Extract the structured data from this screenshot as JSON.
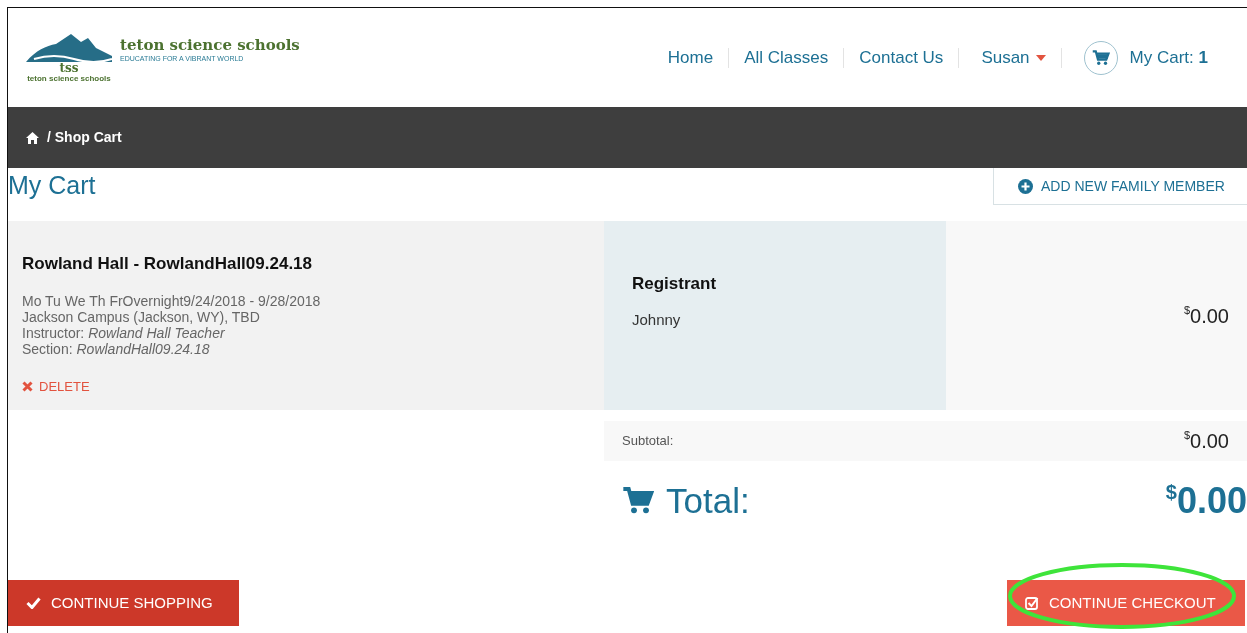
{
  "header": {
    "logo": {
      "name": "teton science schools",
      "tagline": "EDUCATING FOR A VIBRANT WORLD",
      "mark_letters": "tss",
      "mark_caption": "teton science schools"
    },
    "nav": [
      {
        "label": "Home",
        "kind": "link"
      },
      {
        "label": "All Classes",
        "kind": "link"
      },
      {
        "label": "Contact Us",
        "kind": "link"
      },
      {
        "label": "Susan",
        "kind": "dropdown"
      },
      {
        "label": "My Cart:",
        "count": "1",
        "kind": "cart"
      }
    ]
  },
  "breadcrumb": {
    "items": [
      "/ Shop Cart"
    ]
  },
  "page_title": "My Cart",
  "add_member_button": "ADD NEW FAMILY MEMBER",
  "cart_items": [
    {
      "title": "Rowland Hall - RowlandHall09.24.18",
      "schedule": "Mo Tu We Th FrOvernight9/24/2018 - 9/28/2018",
      "location": "Jackson Campus (Jackson, WY), TBD",
      "instructor_label": "Instructor:",
      "instructor": "Rowland Hall Teacher",
      "section_label": "Section:",
      "section": "RowlandHall09.24.18",
      "delete_label": "DELETE",
      "registrant_heading": "Registrant",
      "registrant": "Johnny",
      "price": {
        "symbol": "$",
        "amount": "0.00"
      }
    }
  ],
  "subtotal": {
    "label": "Subtotal:",
    "symbol": "$",
    "amount": "0.00"
  },
  "total": {
    "label": "Total:",
    "symbol": "$",
    "amount": "0.00"
  },
  "buttons": [
    {
      "label": "CONTINUE SHOPPING",
      "kind": "shopping",
      "highlighted": false
    },
    {
      "label": "CONTINUE CHECKOUT",
      "kind": "checkout",
      "highlighted": true
    }
  ]
}
